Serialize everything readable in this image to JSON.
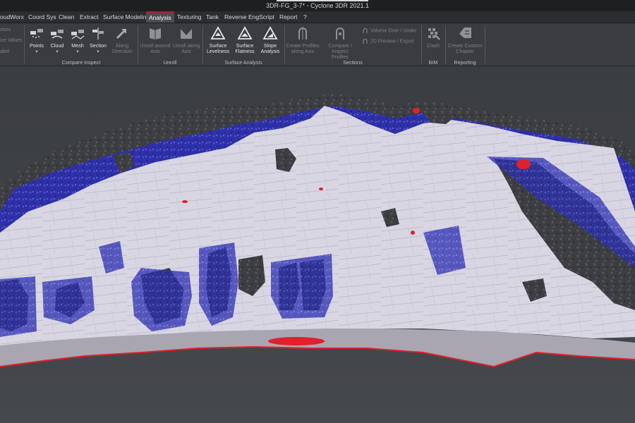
{
  "window": {
    "title": "3DR-FG_3-7* - Cyclone 3DR 2021.1"
  },
  "menu": {
    "tabs": [
      {
        "label": "oudWorx"
      },
      {
        "label": "Coord Sys"
      },
      {
        "label": "Clean"
      },
      {
        "label": "Extract"
      },
      {
        "label": "Surface Modeling"
      },
      {
        "label": "Analysis",
        "active": true
      },
      {
        "label": "Texturing"
      },
      {
        "label": "Tank"
      },
      {
        "label": "Reverse Eng"
      },
      {
        "label": "Script"
      },
      {
        "label": "Report"
      },
      {
        "label": "?"
      }
    ]
  },
  "ribbon": {
    "left_partial": [
      "olors",
      "ize Values",
      "abel"
    ],
    "compare_inspect": {
      "label": "Compare Inspect",
      "buttons": [
        "Points",
        "Cloud",
        "Mesh",
        "Section"
      ],
      "along": [
        "Along",
        "Direction"
      ]
    },
    "unroll": {
      "label": "Unroll",
      "around": [
        "Unroll around",
        "Axis"
      ],
      "along": [
        "Unroll along",
        "Axis"
      ]
    },
    "surface_analysis": {
      "label": "Surface Analysis",
      "levelness": [
        "Surface",
        "Levelness"
      ],
      "flatness": [
        "Surface",
        "Flatness"
      ],
      "slope": [
        "Slope",
        "Analysis"
      ]
    },
    "sections": {
      "label": "Sections",
      "create_profiles": [
        "Create Profiles",
        "along Axis"
      ],
      "compare_profiles": [
        "Compare / Inspect",
        "Profiles"
      ],
      "volume": "Volume Over / Under",
      "preview": "2D Preview / Export"
    },
    "bim": {
      "label": "BIM",
      "clash": "Clash"
    },
    "reporting": {
      "label": "Reporting",
      "custom": [
        "Create Custom",
        "Chapter"
      ]
    }
  },
  "colors": {
    "accent": "#c8102e",
    "background": "#3c3f43",
    "surface": "#d9d8e4",
    "deviation_blue": "#2b2fb8",
    "deviation_red": "#e0202a",
    "rock_dark": "#3f4044"
  },
  "icons": {
    "points": "points-compare-icon",
    "cloud": "cloud-compare-icon",
    "mesh": "mesh-compare-icon",
    "section": "section-compare-icon",
    "along": "arrow-direction-icon",
    "unroll_around": "unroll-around-icon",
    "unroll_along": "unroll-along-icon",
    "levelness": "levelness-icon",
    "flatness": "flatness-icon",
    "slope": "slope-icon",
    "create_profiles": "profiles-axis-icon",
    "compare_profiles": "compare-profiles-icon",
    "volume": "volume-icon",
    "preview": "preview-2d-icon",
    "clash": "clash-icon",
    "custom_chapter": "custom-chapter-icon",
    "ruler": "ruler-icon"
  }
}
